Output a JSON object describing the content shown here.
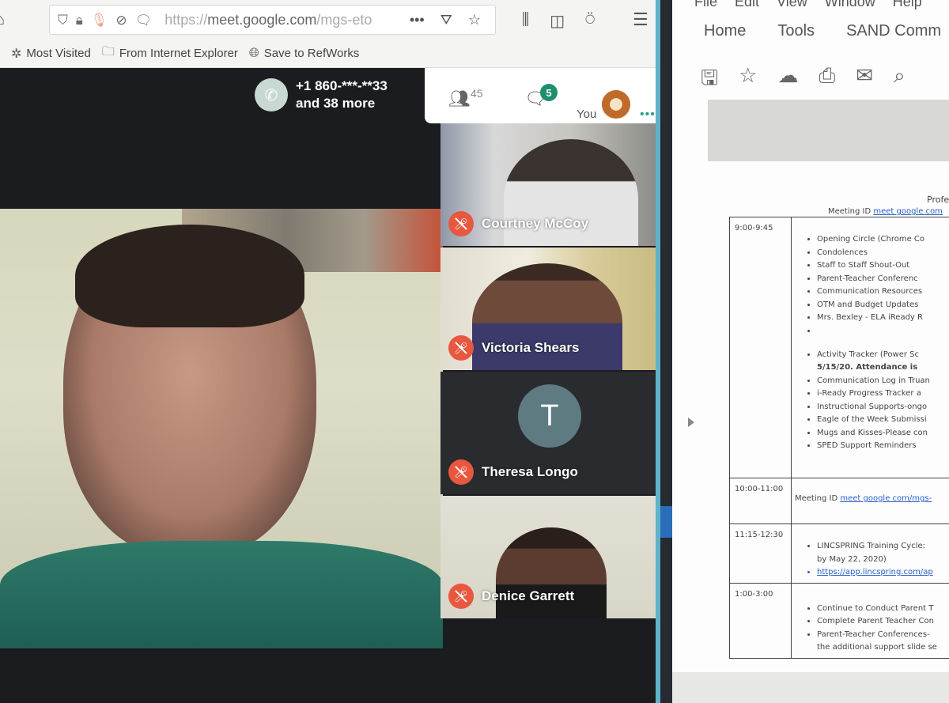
{
  "browser": {
    "url_domain": "meet.google.com",
    "url_prefix": "https://",
    "url_suffix": "/mgs-eto",
    "bookmarks": [
      {
        "icon": "gear-icon",
        "label": "Most Visited"
      },
      {
        "icon": "folder-icon",
        "label": "From Internet Explorer"
      },
      {
        "icon": "globe-icon",
        "label": "Save to RefWorks"
      }
    ]
  },
  "meet": {
    "caller_number": "+1 860-***-**33",
    "caller_more": "and 38 more",
    "people_count": "45",
    "chat_badge": "5",
    "you_label": "You",
    "more_dots": "•••",
    "accent_color": "#1e8e6e",
    "mute_color": "#e8573f",
    "participants": [
      {
        "name": "Courtney McCoy",
        "muted": true
      },
      {
        "name": "Victoria Shears",
        "muted": true
      },
      {
        "name": "Theresa Longo",
        "muted": true,
        "avatar_letter": "T"
      },
      {
        "name": "Denice Garrett",
        "muted": true
      }
    ]
  },
  "acrobat": {
    "menu": [
      "File",
      "Edit",
      "View",
      "Window",
      "Help"
    ],
    "tabs": [
      "Home",
      "Tools",
      "SAND Comm"
    ],
    "document": {
      "title": "Profe",
      "meeting_id_label": "Meeting ID",
      "meeting_id_link": "meet google com",
      "rows": [
        {
          "time": "9:00-9:45",
          "items": [
            "Opening Circle (Chrome Co",
            "Condolences",
            "Staff to Staff Shout-Out",
            "Parent-Teacher Conferenc",
            "Communication Resources",
            "OTM and Budget Updates",
            "Mrs. Bexley - ELA iReady R",
            "",
            "Activity Tracker (Power Sc",
            "5/15/20.  Attendance is",
            "Communication Log in Truan",
            "i-Ready Progress Tracker a",
            "Instructional Supports-ongo",
            "Eagle of the Week Submissi",
            "Mugs and Kisses-Please con",
            "SPED Support Reminders"
          ]
        },
        {
          "time": "10:00-11:00",
          "meeting_label": "Meeting ID",
          "meeting_link": "meet google com/mgs-"
        },
        {
          "time": "11:15-12:30",
          "items": [
            "LINCSPRING Training Cycle:",
            "by May 22, 2020)",
            "https://app.lincspring.com/ap"
          ]
        },
        {
          "time": "1:00-3:00",
          "items": [
            "Continue to Conduct Parent T",
            "Complete Parent Teacher Con",
            "Parent-Teacher Conferences-",
            "the additional support slide se"
          ]
        }
      ]
    }
  }
}
